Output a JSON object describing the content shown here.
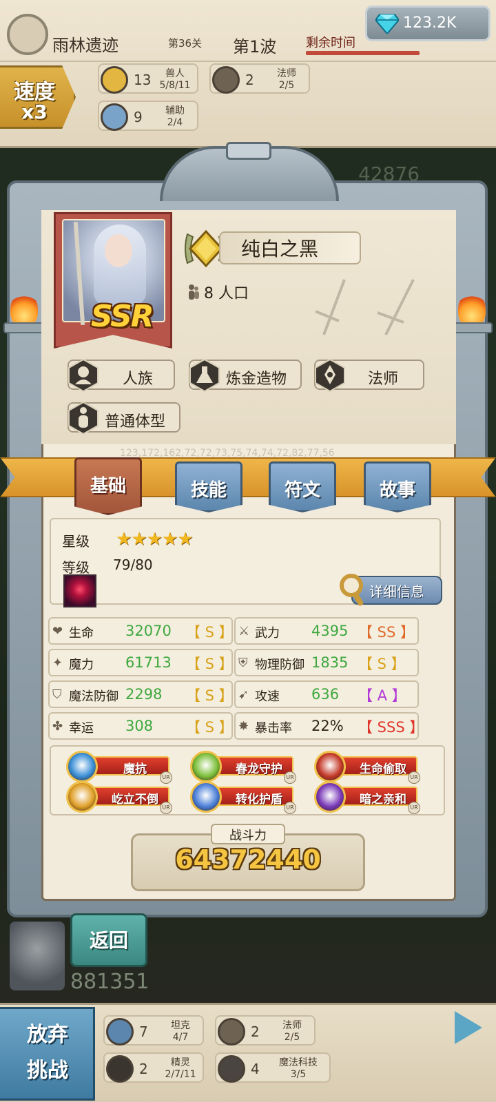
{
  "hud": {
    "stage_name": "雨林遗迹",
    "stage_level": "第36关",
    "wave": "第1波",
    "remaining_time_label": "剩余时间",
    "gems": "123.2K",
    "speed_line1": "速度",
    "speed_line2": "x3",
    "top_factions": [
      {
        "count": "13",
        "name": "兽人",
        "progress": "5/8/11",
        "icon": "claw-icon"
      },
      {
        "count": "2",
        "name": "法师",
        "progress": "2/5",
        "icon": "mage-icon"
      },
      {
        "count": "9",
        "name": "辅助",
        "progress": "2/4",
        "icon": "support-icon"
      }
    ],
    "bottom_factions": [
      {
        "count": "7",
        "name": "坦克",
        "progress": "4/7",
        "icon": "shield-icon"
      },
      {
        "count": "2",
        "name": "法师",
        "progress": "2/5",
        "icon": "mage-icon"
      },
      {
        "count": "2",
        "name": "精灵",
        "progress": "2/7/11",
        "icon": "elf-icon"
      },
      {
        "count": "4",
        "name": "魔法科技",
        "progress": "3/5",
        "icon": "magitech-icon"
      }
    ],
    "quit_line1": "放弃",
    "quit_line2": "挑战",
    "background_score_top": "42876",
    "background_score_bottom": "881351"
  },
  "hero": {
    "name": "纯白之黑",
    "population": "8 人口",
    "rarity": "SSR",
    "tags": [
      "人族",
      "炼金造物",
      "法师",
      "普通体型"
    ],
    "debug_numbers": "123,172,162,72,72,73,75,74,74,72,82,77,56"
  },
  "tabs": [
    {
      "label": "基础",
      "active": true
    },
    {
      "label": "技能",
      "active": false
    },
    {
      "label": "符文",
      "active": false
    },
    {
      "label": "故事",
      "active": false
    }
  ],
  "basic": {
    "star_label": "星级",
    "stars": "★★★★★",
    "star_count": 5,
    "level_label": "等级",
    "level_value": "79/80",
    "detail_button": "详细信息"
  },
  "stats": [
    {
      "name": "生命",
      "value": "32070",
      "grade": "【 S 】",
      "grade_color": "#d9a21a",
      "value_color": "#3ea83e",
      "icon": "heart-icon"
    },
    {
      "name": "武力",
      "value": "4395",
      "grade": "【 SS 】",
      "grade_color": "#e06a2a",
      "value_color": "#3ea83e",
      "icon": "sword-icon"
    },
    {
      "name": "魔力",
      "value": "61713",
      "grade": "【 S 】",
      "grade_color": "#d9a21a",
      "value_color": "#3ea83e",
      "icon": "sparkle-icon"
    },
    {
      "name": "物理防御",
      "value": "1835",
      "grade": "【 S 】",
      "grade_color": "#d9a21a",
      "value_color": "#3ea83e",
      "icon": "shield-icon"
    },
    {
      "name": "魔法防御",
      "value": "2298",
      "grade": "【 S 】",
      "grade_color": "#d9a21a",
      "value_color": "#3ea83e",
      "icon": "magic-shield-icon"
    },
    {
      "name": "攻速",
      "value": "636",
      "grade": "【 A 】",
      "grade_color": "#b23ad6",
      "value_color": "#3ea83e",
      "icon": "speed-icon"
    },
    {
      "name": "幸运",
      "value": "308",
      "grade": "【 S 】",
      "grade_color": "#d9a21a",
      "value_color": "#3ea83e",
      "icon": "clover-icon"
    },
    {
      "name": "暴击率",
      "value": "22%",
      "grade": "【 SSS 】",
      "grade_color": "#e0342a",
      "value_color": "#2f2419",
      "icon": "crit-icon"
    }
  ],
  "traits": [
    {
      "name": "魔抗",
      "icon_color": "#3b8fd6",
      "icon": "magic-resist-icon"
    },
    {
      "name": "春龙守护",
      "icon_color": "#7cbf3a",
      "icon": "spring-dragon-icon"
    },
    {
      "name": "生命偷取",
      "icon_color": "#c43a2a",
      "icon": "lifesteal-icon"
    },
    {
      "name": "屹立不倒",
      "icon_color": "#e0a02a",
      "icon": "unyielding-icon"
    },
    {
      "name": "转化护盾",
      "icon_color": "#4a7fd8",
      "icon": "convert-shield-icon"
    },
    {
      "name": "暗之亲和",
      "icon_color": "#7a3ab8",
      "icon": "dark-affinity-icon"
    }
  ],
  "trait_badge": "UR",
  "combat_power_label": "战斗力",
  "combat_power": "64372440",
  "back_button": "返回"
}
